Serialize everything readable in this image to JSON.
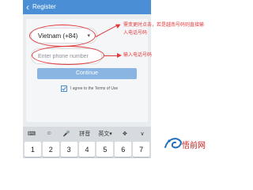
{
  "app": {
    "title": "Register",
    "country_value": "Vietnam (+84)",
    "phone_placeholder": "Enter phone number",
    "continue_label": "Continue",
    "terms_text": "I agree to the Terms of Use"
  },
  "annotations": {
    "note1": [
      "需变更时点击，若是越南号码则直接输",
      "入电话号码"
    ],
    "note2": "输入电话号码"
  },
  "keyboard": {
    "toolbar": [
      "⌨",
      "☺",
      "🎤",
      "拼音",
      "英文▾",
      "✥",
      "∨"
    ],
    "keys": [
      "1",
      "2",
      "3",
      "4",
      "5",
      "6",
      "7"
    ]
  },
  "colors": {
    "titlebar": "#4a8fd6",
    "continue_button": "#8ab5e3",
    "annotation": "#e23b3b"
  },
  "watermark": "悟前网"
}
